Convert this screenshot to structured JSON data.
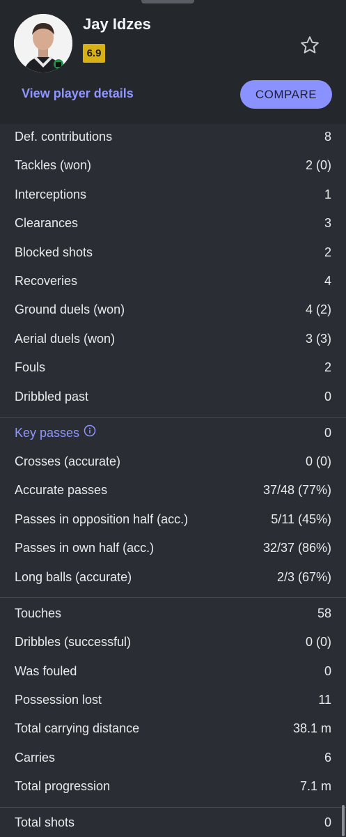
{
  "player": {
    "name": "Jay Idzes",
    "rating": "6.9",
    "details_link": "View player details",
    "compare_label": "COMPARE"
  },
  "defensive": [
    {
      "label": "Def. contributions",
      "value": "8"
    },
    {
      "label": "Tackles (won)",
      "value": "2 (0)"
    },
    {
      "label": "Interceptions",
      "value": "1"
    },
    {
      "label": "Clearances",
      "value": "3"
    },
    {
      "label": "Blocked shots",
      "value": "2"
    },
    {
      "label": "Recoveries",
      "value": "4"
    },
    {
      "label": "Ground duels (won)",
      "value": "4 (2)"
    },
    {
      "label": "Aerial duels (won)",
      "value": "3 (3)"
    },
    {
      "label": "Fouls",
      "value": "2"
    },
    {
      "label": "Dribbled past",
      "value": "0"
    }
  ],
  "passing": [
    {
      "label": "Key passes",
      "value": "0"
    },
    {
      "label": "Crosses (accurate)",
      "value": "0 (0)"
    },
    {
      "label": "Accurate passes",
      "value": "37/48 (77%)"
    },
    {
      "label": "Passes in opposition half (acc.)",
      "value": "5/11 (45%)"
    },
    {
      "label": "Passes in own half (acc.)",
      "value": "32/37 (86%)"
    },
    {
      "label": "Long balls (accurate)",
      "value": "2/3 (67%)"
    }
  ],
  "possession": [
    {
      "label": "Touches",
      "value": "58"
    },
    {
      "label": "Dribbles (successful)",
      "value": "0 (0)"
    },
    {
      "label": "Was fouled",
      "value": "0"
    },
    {
      "label": "Possession lost",
      "value": "11"
    },
    {
      "label": "Total carrying distance",
      "value": "38.1 m"
    },
    {
      "label": "Carries",
      "value": "6"
    },
    {
      "label": "Total progression",
      "value": "7.1 m"
    }
  ],
  "shooting": [
    {
      "label": "Total shots",
      "value": "0"
    }
  ],
  "colors": {
    "background": "#2a2d33",
    "header": "#24272c",
    "accent": "#8a92ff",
    "rating_badge": "#d7b116"
  },
  "icons": [
    "star-outline-icon",
    "info-icon"
  ]
}
